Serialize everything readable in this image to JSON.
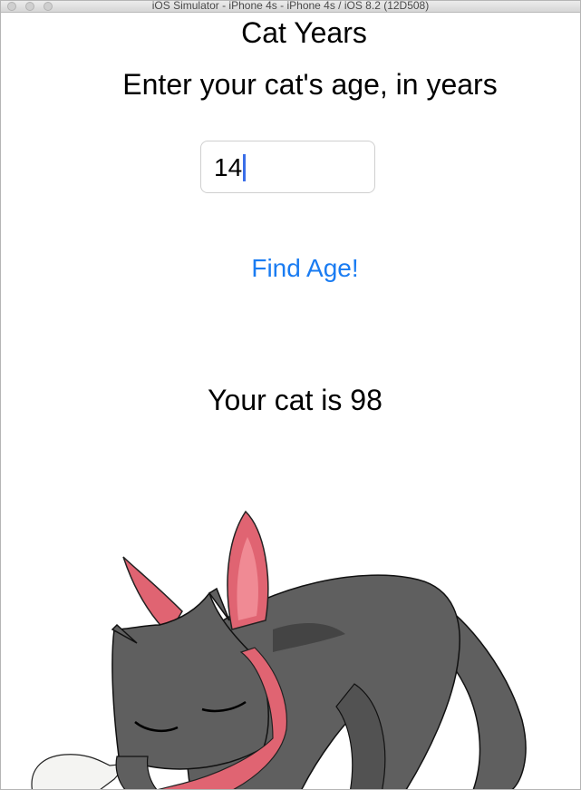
{
  "window": {
    "title": "iOS Simulator - iPhone 4s - iPhone 4s / iOS 8.2 (12D508)"
  },
  "app": {
    "title": "Cat Years",
    "prompt": "Enter your cat's age, in years",
    "age_input_value": "14",
    "find_button_label": "Find Age!",
    "result_text": "Your cat is 98"
  },
  "colors": {
    "button_blue": "#1a7cf2",
    "cursor_blue": "#3a6ee8",
    "cat_body": "#5f5f5f",
    "bow_pink": "#e06472"
  }
}
